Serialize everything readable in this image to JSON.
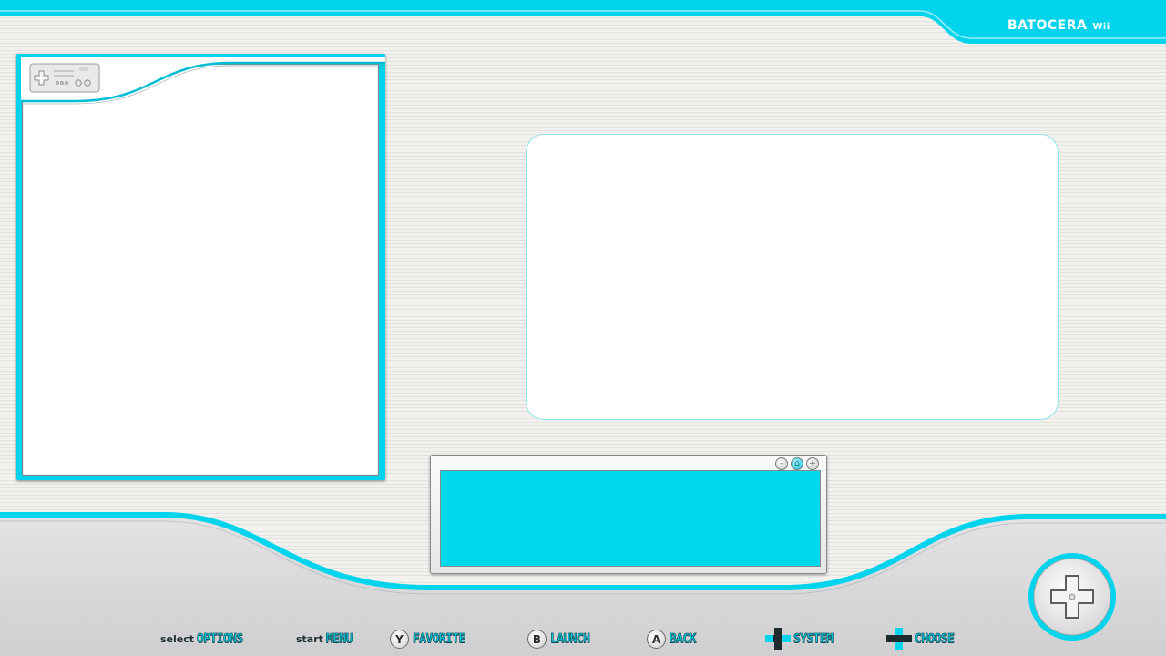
{
  "header": {
    "brand": "BATOCERA",
    "system": "Wii"
  },
  "colors": {
    "accent": "#00d4ec",
    "background": "#efeeea",
    "bottom_band": "#d6d6d8"
  },
  "icons": {
    "cover_badge": "wii-remote-icon",
    "window_controls": [
      "minus-icon",
      "home-icon",
      "plus-icon"
    ],
    "corner_button": "dpad-icon"
  },
  "helpbar": {
    "items": [
      {
        "prefix": "select",
        "label": "OPTIONS"
      },
      {
        "prefix": "start",
        "label": "MENU"
      },
      {
        "button": "Y",
        "label": "FAVORITE"
      },
      {
        "button": "B",
        "label": "LAUNCH"
      },
      {
        "button": "A",
        "label": "BACK"
      },
      {
        "icon": "dpad-horizontal-icon",
        "label": "SYSTEM"
      },
      {
        "icon": "dpad-vertical-icon",
        "label": "CHOOSE"
      }
    ]
  }
}
